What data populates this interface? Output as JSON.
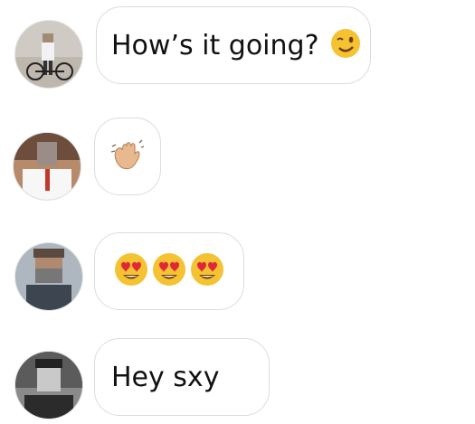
{
  "messages": [
    {
      "text": "How’s it going?",
      "emoji": [
        "winking-face"
      ]
    },
    {
      "text": "",
      "emoji": [
        "waving-hand"
      ]
    },
    {
      "text": "",
      "emoji": [
        "heart-eyes-face",
        "heart-eyes-face",
        "heart-eyes-face"
      ]
    },
    {
      "text": "Hey sxy",
      "emoji": []
    }
  ]
}
